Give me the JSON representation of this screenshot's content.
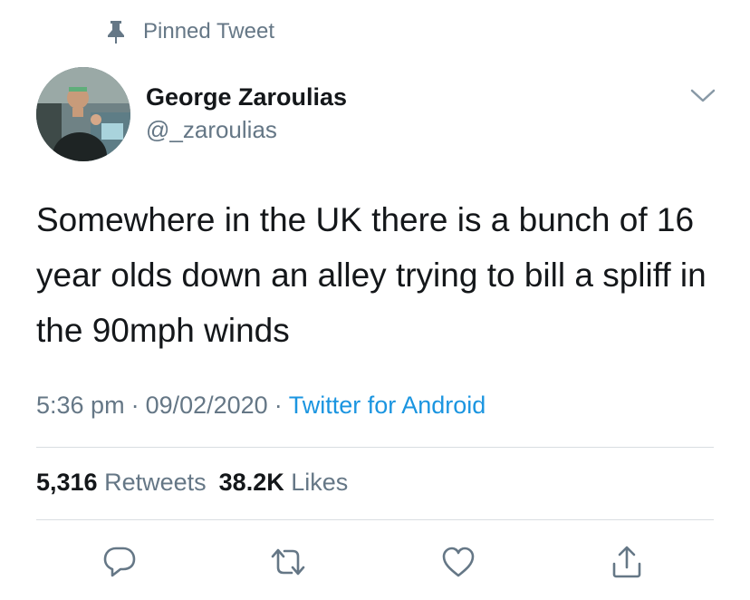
{
  "pinned": {
    "label": "Pinned Tweet",
    "icon": "pin-icon"
  },
  "author": {
    "name": "George Zaroulias",
    "handle": "@_zaroulias",
    "avatar_icon": "avatar-photo"
  },
  "tweet": {
    "text": "Somewhere in the UK there is a bunch of 16 year olds down an alley trying to bill a spliff in the 90mph winds",
    "time": "5:36 pm",
    "date": "09/02/2020",
    "separator": "·",
    "source": "Twitter for Android"
  },
  "stats": {
    "retweets_count": "5,316",
    "retweets_label": "Retweets",
    "likes_count": "38.2K",
    "likes_label": "Likes"
  },
  "actions": {
    "reply_icon": "reply-icon",
    "retweet_icon": "retweet-icon",
    "like_icon": "heart-icon",
    "share_icon": "share-icon"
  },
  "menu_icon": "chevron-down-icon",
  "colors": {
    "text": "#14171a",
    "secondary": "#657786",
    "link": "#1b95e0",
    "divider": "#d9dee2"
  }
}
